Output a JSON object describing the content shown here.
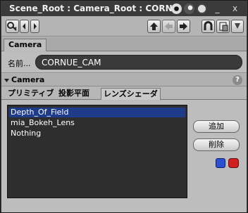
{
  "window": {
    "title": "Scene_Root : Camera_Root : CORNUE_..."
  },
  "titlebar": {
    "minimize_label": "_",
    "close_label": "x"
  },
  "tabs": {
    "camera_label": "Camera"
  },
  "name_row": {
    "label": "名前",
    "value": "CORNUE_CAM"
  },
  "section": {
    "title": "Camera",
    "help_label": "?"
  },
  "subtabs": [
    "プリミティブ",
    "投影平面",
    "レンズシェーダ"
  ],
  "shaders": {
    "items": [
      "Depth_Of_Field",
      "mia_Bokeh_Lens",
      "Nothing"
    ],
    "selected_index": 0,
    "add_label": "追加",
    "delete_label": "削除"
  },
  "colors": {
    "selection": "#1e3c8a",
    "name_field_bg": "#3a3a3a"
  }
}
